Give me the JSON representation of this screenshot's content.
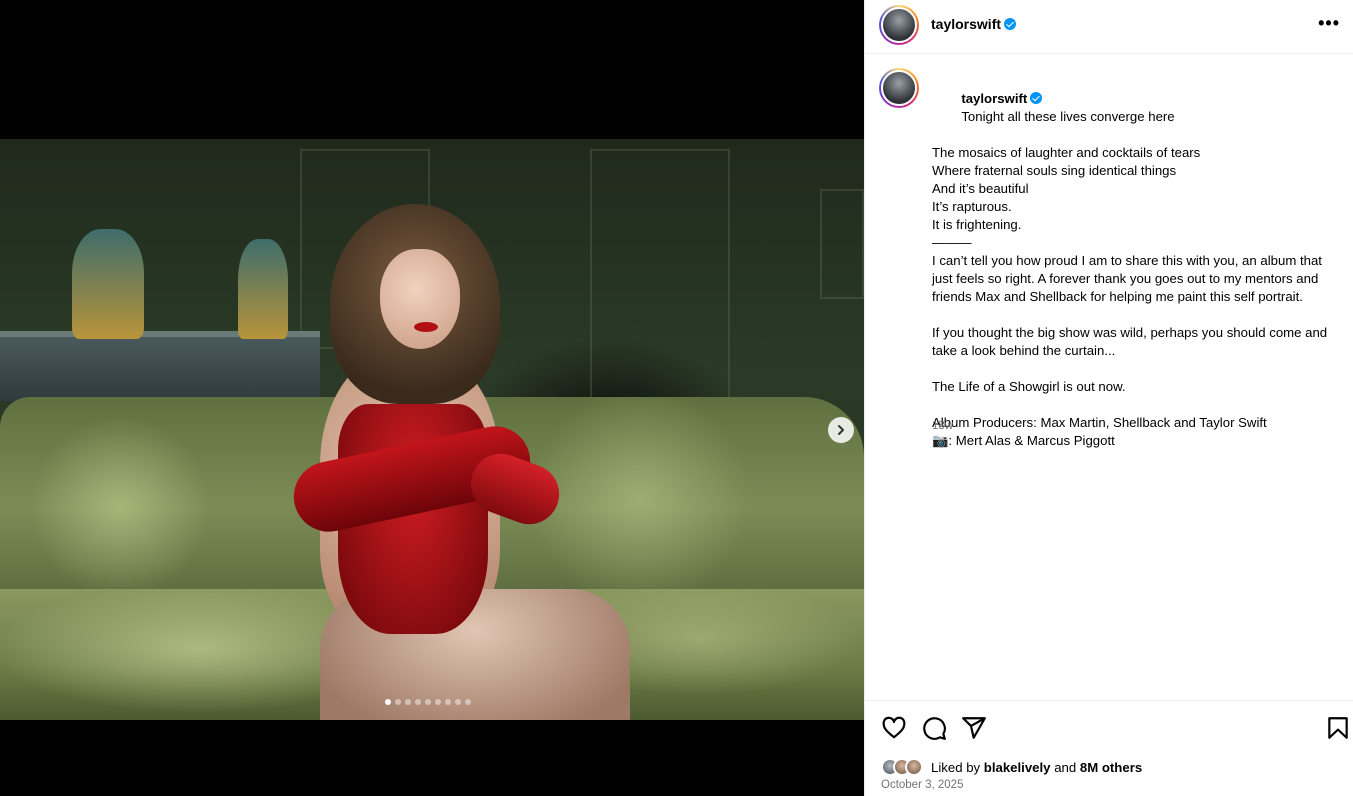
{
  "post": {
    "author": "taylorswift",
    "verified": true,
    "media": {
      "carousel_count": 9,
      "active_index": 0,
      "next_icon": "chevron-right-icon"
    },
    "caption_lines": [
      "Tonight all these lives converge here",
      "The mosaics of laughter and cocktails of tears",
      "Where fraternal souls sing identical things",
      "And it’s beautiful",
      "It’s rapturous.",
      "It is frightening.",
      "———",
      "I can’t tell you how proud I am to share this with you, an album that just feels so right. A forever thank you goes out to my mentors and friends Max and Shellback for helping me paint this self portrait.",
      "",
      "If you thought the big show was wild, perhaps you should come and take a look behind the curtain...",
      "",
      "The Life of a Showgirl is out now.",
      "",
      "Album Producers: Max Martin, Shellback and Taylor Swift",
      "📷: Mert Alas & Marcus Piggott"
    ],
    "caption_age": "18w",
    "likes": {
      "prefix": "Liked by",
      "user": "blakelively",
      "connector": "and",
      "others": "8M others"
    },
    "date": "October 3, 2025"
  },
  "icons": {
    "like": "heart-icon",
    "comment": "comment-icon",
    "share": "share-icon",
    "save": "bookmark-icon",
    "more": "more-options-icon"
  }
}
